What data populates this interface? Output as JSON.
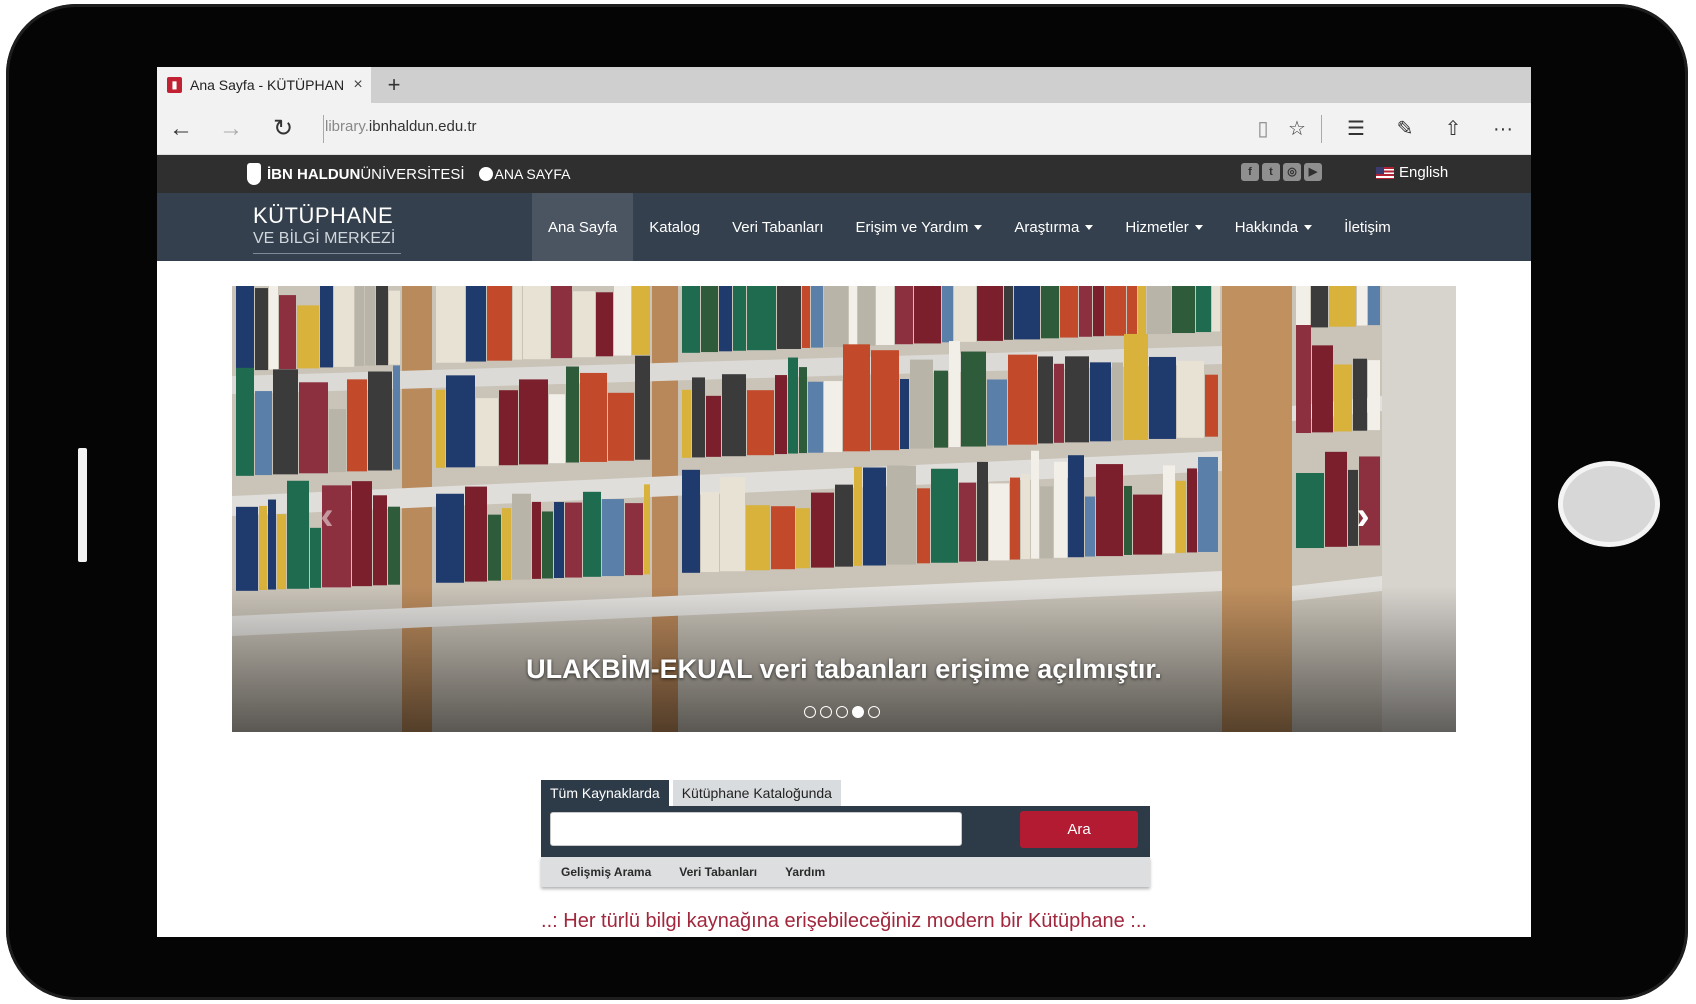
{
  "browser": {
    "tab_title": "Ana Sayfa - KÜTÜPHAN",
    "tab_favicon": "ibn-haldun-favicon",
    "url_subdomain": "library.",
    "url_domain": "ibnhaldun.edu.tr",
    "new_tab_glyph": "+",
    "close_tab_glyph": "×",
    "back_glyph": "←",
    "forward_glyph": "→",
    "refresh_glyph": "↻",
    "reading_view_glyph": "▯",
    "favorite_glyph": "☆",
    "hub_glyph": "☰",
    "note_glyph": "✎",
    "share_glyph": "⇧",
    "more_glyph": "···"
  },
  "site": {
    "university_bold": "İBN HALDUN",
    "university_rest": "ÜNİVERSİTESİ",
    "home_link": "ANA SAYFA",
    "language": "English",
    "social_icons": [
      "facebook-icon",
      "twitter-icon",
      "instagram-icon",
      "youtube-icon"
    ],
    "brand_line1": "KÜTÜPHANE",
    "brand_line2": "VE BİLGİ MERKEZİ",
    "menu": [
      {
        "label": "Ana Sayfa",
        "active": true,
        "dropdown": false
      },
      {
        "label": "Katalog",
        "active": false,
        "dropdown": false
      },
      {
        "label": "Veri Tabanları",
        "active": false,
        "dropdown": false
      },
      {
        "label": "Erişim ve Yardım",
        "active": false,
        "dropdown": true
      },
      {
        "label": "Araştırma",
        "active": false,
        "dropdown": true
      },
      {
        "label": "Hizmetler",
        "active": false,
        "dropdown": true
      },
      {
        "label": "Hakkında",
        "active": false,
        "dropdown": true
      },
      {
        "label": "İletişim",
        "active": false,
        "dropdown": false
      }
    ]
  },
  "hero": {
    "caption": "ULAKBİM-EKUAL veri tabanları erişime açılmıştır.",
    "slide_count": 5,
    "active_slide": 4
  },
  "search": {
    "tabs": [
      "Tüm Kaynaklarda",
      "Kütüphane Kataloğunda"
    ],
    "active_tab": 0,
    "input_value": "",
    "button_label": "Ara",
    "links": [
      "Gelişmiş Arama",
      "Veri Tabanları",
      "Yardım"
    ]
  },
  "tagline": "..: Her türlü bilgi kaynağına erişebileceğiniz modern bir Kütüphane :..",
  "colors": {
    "nav_bg": "#34404d",
    "topbar_bg": "#2f2f2f",
    "accent_red": "#b31b32",
    "tagline": "#a2263c"
  }
}
